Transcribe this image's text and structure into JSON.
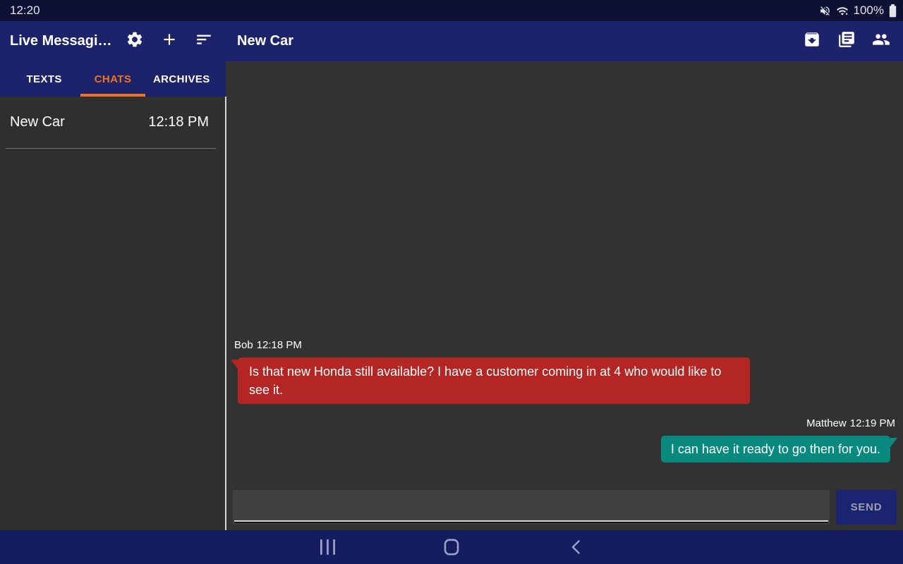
{
  "colors": {
    "app_bar": "#1c236b",
    "status_bar": "#0e1134",
    "nav_bar": "#151c60",
    "tab_accent": "#f0731f",
    "incoming_bubble": "#b42623",
    "outgoing_bubble": "#0a8a7f",
    "send_button": "#1b2470"
  },
  "status_bar": {
    "time": "12:20",
    "battery": "100%",
    "icons": [
      "volume-muted-icon",
      "wifi-icon",
      "battery-icon"
    ]
  },
  "app_bar": {
    "app_title": "Live Messagi…",
    "left_icons": [
      "settings-icon",
      "add-icon",
      "sort-icon"
    ],
    "chat_title": "New Car",
    "right_icons": [
      "archive-icon",
      "templates-icon",
      "contacts-icon"
    ]
  },
  "tabs": [
    {
      "label": "TEXTS",
      "active": false
    },
    {
      "label": "CHATS",
      "active": true
    },
    {
      "label": "ARCHIVES",
      "active": false
    }
  ],
  "conversation_list": [
    {
      "name": "New Car",
      "time": "12:18 PM"
    }
  ],
  "chat": {
    "messages": [
      {
        "sender": "Bob",
        "time": "12:18 PM",
        "side": "left",
        "text": "Is that new Honda still available? I have a customer coming in at 4 who would like to see it."
      },
      {
        "sender": "Matthew",
        "time": "12:19 PM",
        "side": "right",
        "text": "I can have it ready to go then for you."
      }
    ],
    "composer": {
      "input_value": "",
      "send_label": "SEND"
    }
  },
  "nav_bar": {
    "icons": [
      "recents-icon",
      "home-icon",
      "back-icon"
    ]
  }
}
